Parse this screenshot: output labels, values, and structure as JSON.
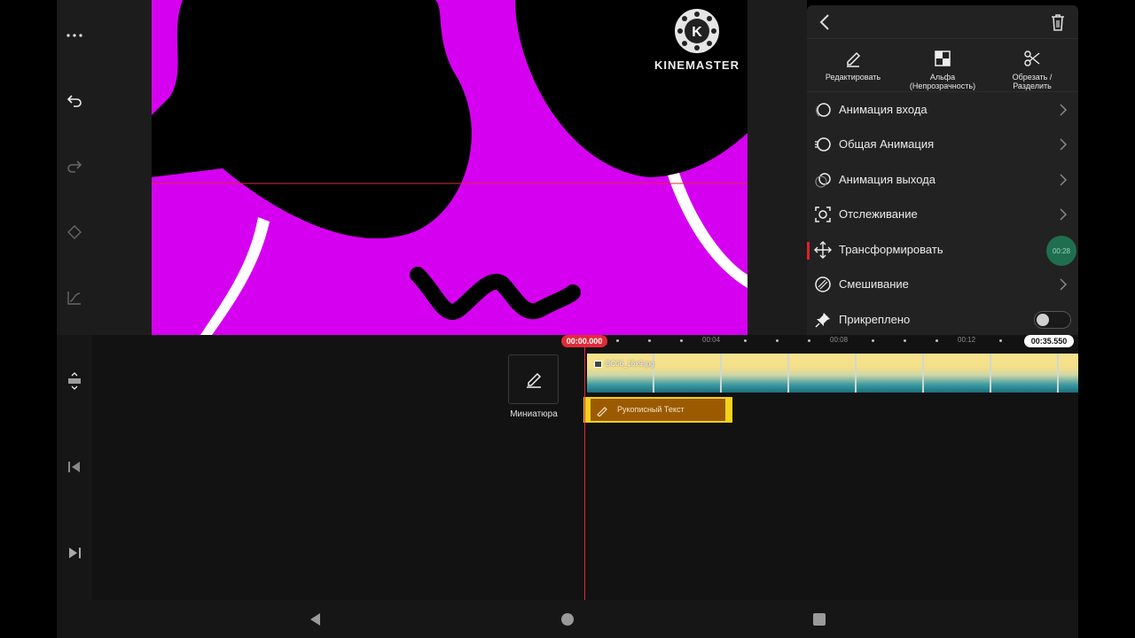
{
  "left_toolbar": {
    "icons": [
      "more-icon",
      "undo-icon",
      "redo-icon",
      "keyframe-icon",
      "chart-icon"
    ]
  },
  "preview": {
    "watermark": "KINEMASTER",
    "logo_letter": "K",
    "canvas_color": "#d600f0"
  },
  "panel": {
    "tools": [
      {
        "label": "Редактировать",
        "icon": "pencil-icon"
      },
      {
        "label": "Альфа\n(Непрозрачность)",
        "icon": "alpha-icon"
      },
      {
        "label": "Обрезать /\nРазделить",
        "icon": "scissors-icon"
      }
    ],
    "menu": [
      {
        "label": "Анимация входа",
        "icon": "in-animation-icon"
      },
      {
        "label": "Общая Анимация",
        "icon": "overall-animation-icon"
      },
      {
        "label": "Анимация выхода",
        "icon": "out-animation-icon"
      },
      {
        "label": "Отслеживание",
        "icon": "tracking-icon"
      },
      {
        "label": "Трансформировать",
        "icon": "transform-icon",
        "badge": "00:28"
      },
      {
        "label": "Смешивание",
        "icon": "blend-icon"
      },
      {
        "label": "Прикреплено",
        "icon": "pin-icon",
        "toggle": false
      }
    ]
  },
  "timeline": {
    "current_time": "00:00.000",
    "end_time": "00:35.550",
    "ticks": [
      "00:04",
      "00:08",
      "00:12"
    ],
    "thumbnail_label": "Миниатюра",
    "main_clip_name": "BC06_16x9.jpg",
    "text_clip_name": "Рукописный Текст"
  },
  "colors": {
    "accent_red": "#e12b37",
    "clip_yellow": "#f2d21b",
    "text_clip": "#9b5a00"
  }
}
